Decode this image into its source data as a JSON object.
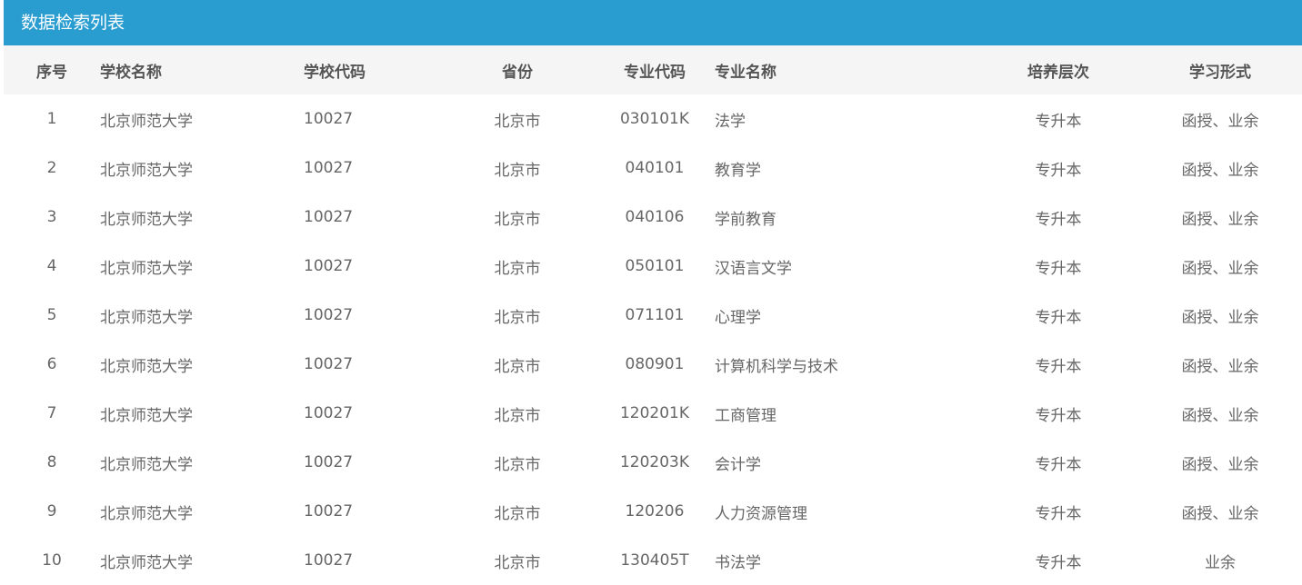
{
  "panel": {
    "title": "数据检索列表"
  },
  "table": {
    "headers": [
      "序号",
      "学校名称",
      "学校代码",
      "省份",
      "专业代码",
      "专业名称",
      "培养层次",
      "学习形式"
    ],
    "rows": [
      [
        "1",
        "北京师范大学",
        "10027",
        "北京市",
        "030101K",
        "法学",
        "专升本",
        "函授、业余"
      ],
      [
        "2",
        "北京师范大学",
        "10027",
        "北京市",
        "040101",
        "教育学",
        "专升本",
        "函授、业余"
      ],
      [
        "3",
        "北京师范大学",
        "10027",
        "北京市",
        "040106",
        "学前教育",
        "专升本",
        "函授、业余"
      ],
      [
        "4",
        "北京师范大学",
        "10027",
        "北京市",
        "050101",
        "汉语言文学",
        "专升本",
        "函授、业余"
      ],
      [
        "5",
        "北京师范大学",
        "10027",
        "北京市",
        "071101",
        "心理学",
        "专升本",
        "函授、业余"
      ],
      [
        "6",
        "北京师范大学",
        "10027",
        "北京市",
        "080901",
        "计算机科学与技术",
        "专升本",
        "函授、业余"
      ],
      [
        "7",
        "北京师范大学",
        "10027",
        "北京市",
        "120201K",
        "工商管理",
        "专升本",
        "函授、业余"
      ],
      [
        "8",
        "北京师范大学",
        "10027",
        "北京市",
        "120203K",
        "会计学",
        "专升本",
        "函授、业余"
      ],
      [
        "9",
        "北京师范大学",
        "10027",
        "北京市",
        "120206",
        "人力资源管理",
        "专升本",
        "函授、业余"
      ],
      [
        "10",
        "北京师范大学",
        "10027",
        "北京市",
        "130405T",
        "书法学",
        "专升本",
        "业余"
      ]
    ]
  },
  "colors": {
    "header_bar": "#2a9dd0",
    "table_head_bg": "#f5f5f5",
    "text": "#666666"
  }
}
